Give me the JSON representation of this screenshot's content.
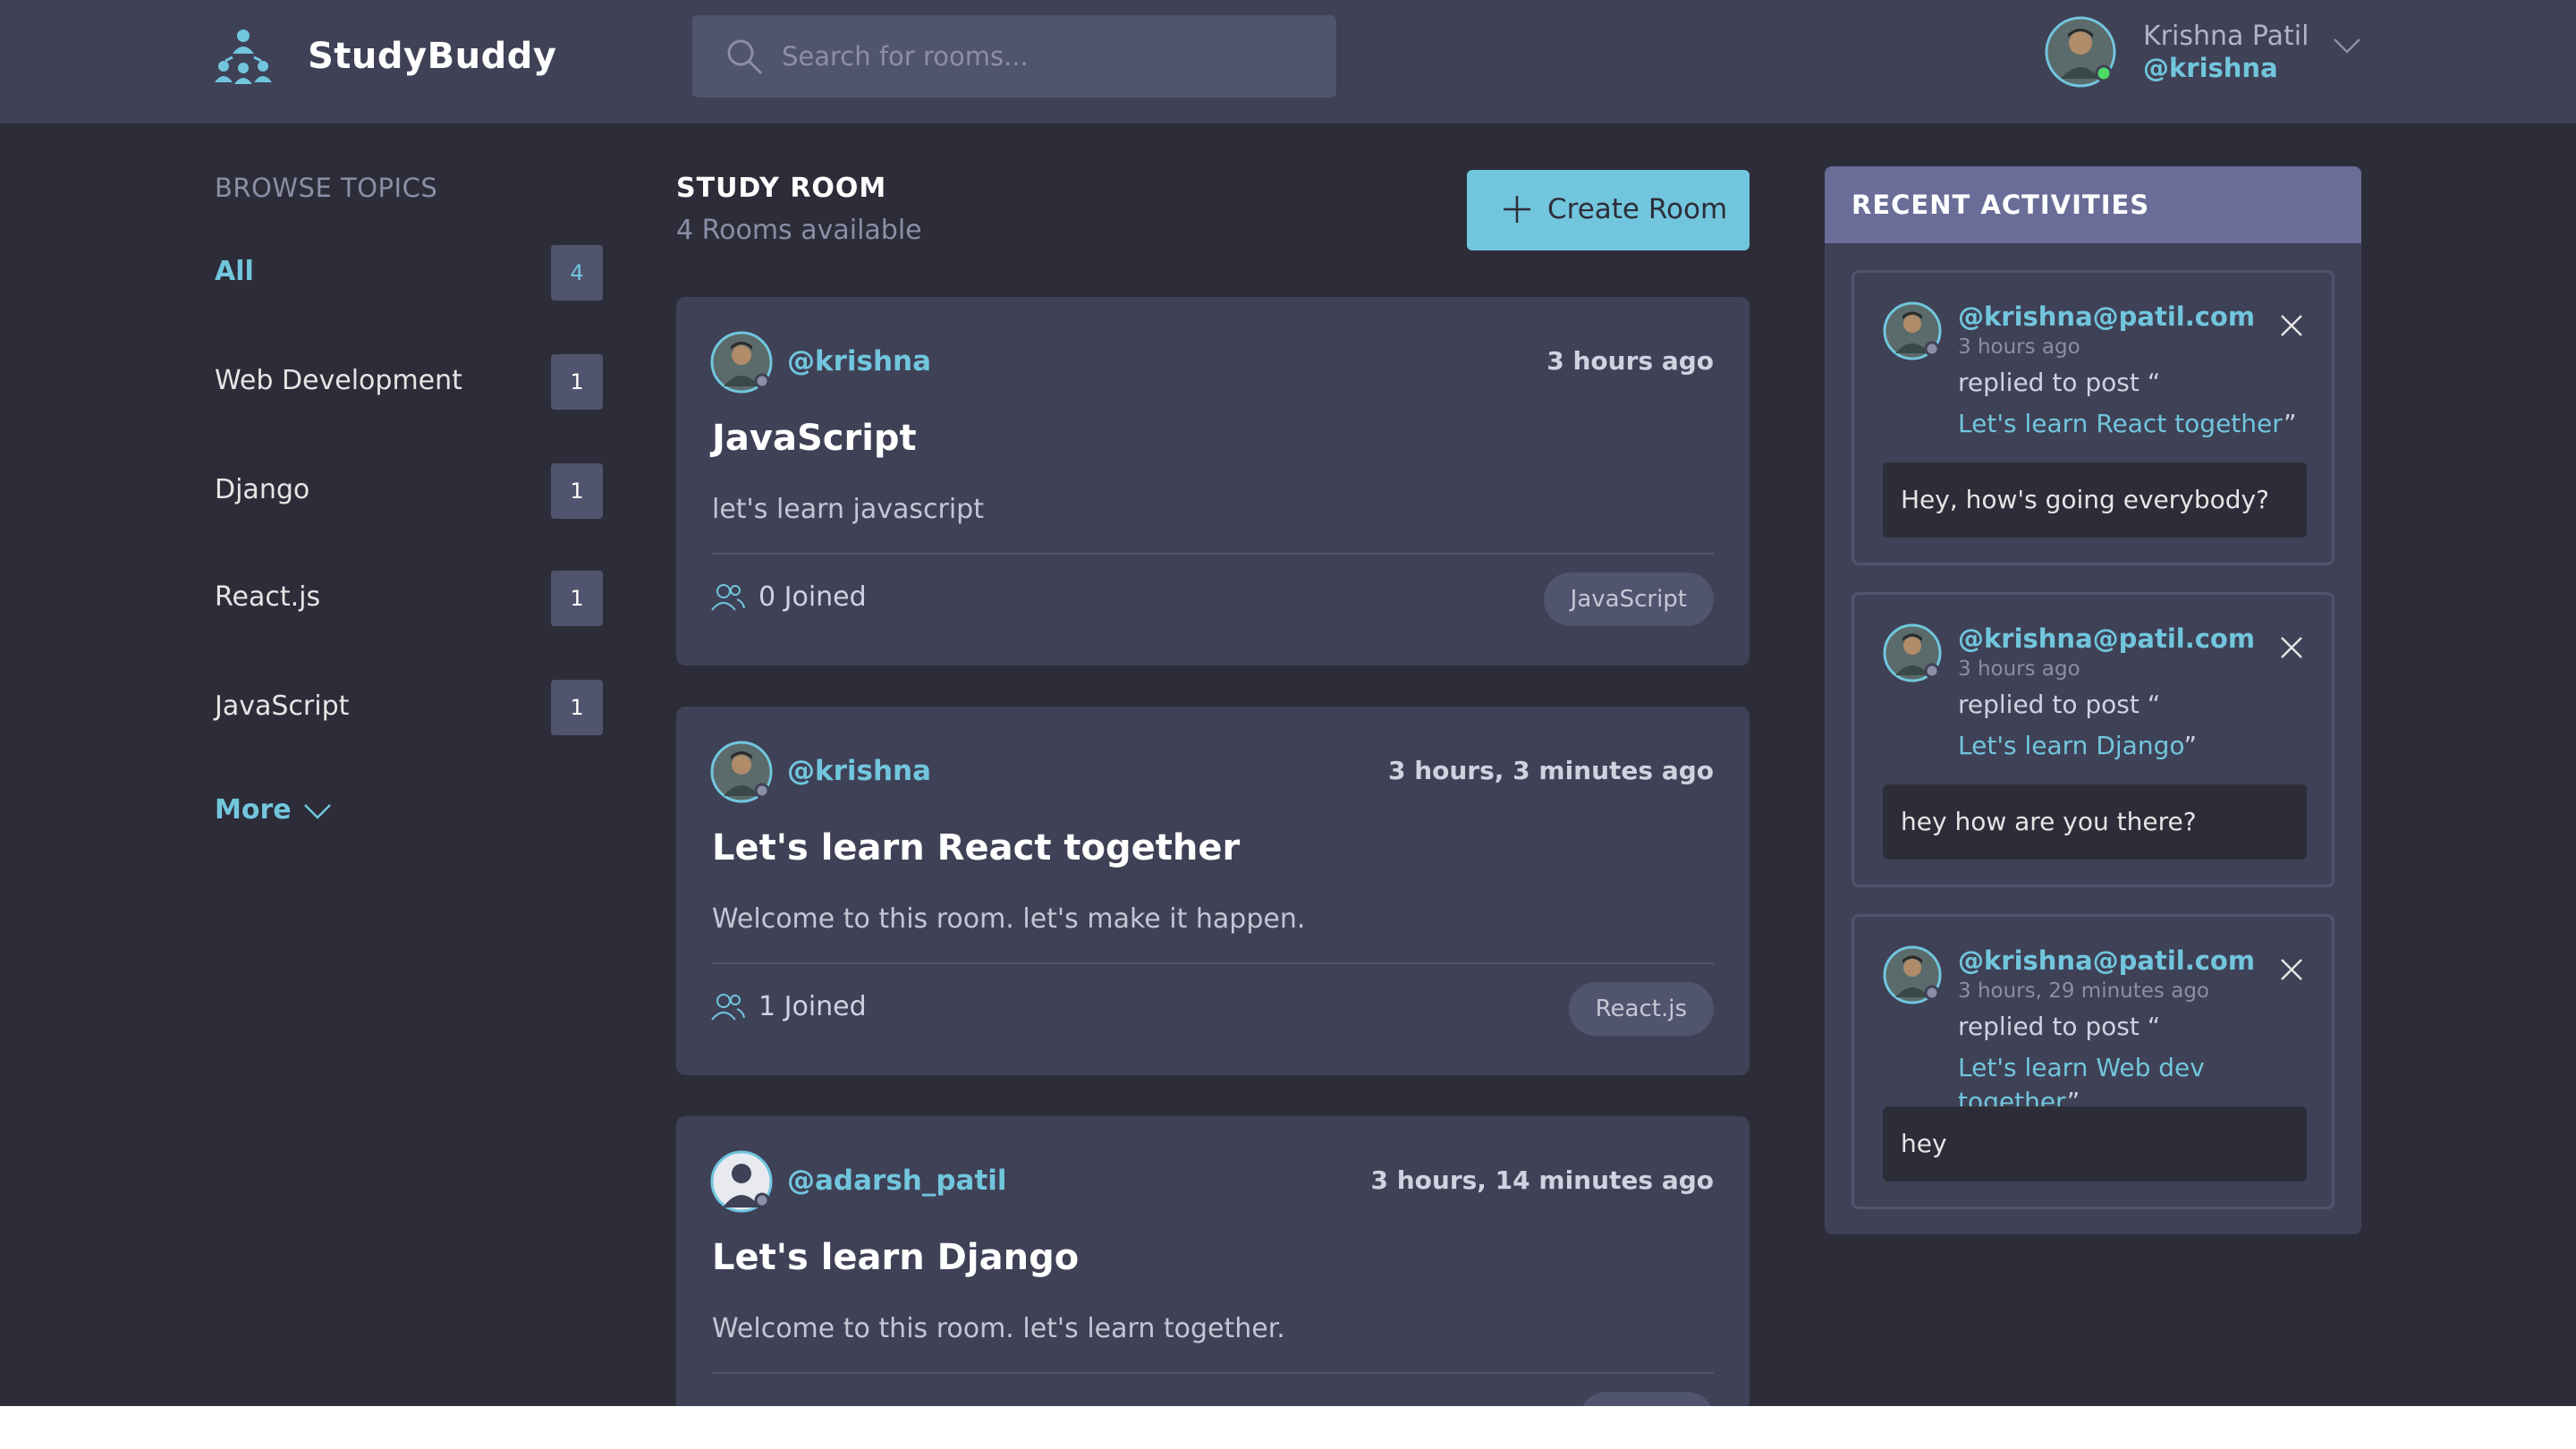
{
  "header": {
    "brand": "StudyBuddy",
    "search_placeholder": "Search for rooms...",
    "user_name": "Krishna Patil",
    "user_handle": "@krishna"
  },
  "sidebar": {
    "title": "BROWSE TOPICS",
    "topics": [
      {
        "label": "All",
        "count": "4",
        "active": true
      },
      {
        "label": "Web Development",
        "count": "1"
      },
      {
        "label": "Django",
        "count": "1"
      },
      {
        "label": "React.js",
        "count": "1"
      },
      {
        "label": "JavaScript",
        "count": "1"
      }
    ],
    "more_label": "More"
  },
  "main": {
    "heading": "STUDY ROOM",
    "subheading": "4 Rooms available",
    "create_label": "Create Room",
    "rooms": [
      {
        "author": "@krishna",
        "time": "3 hours ago",
        "title": "JavaScript",
        "description": "let's learn javascript",
        "joined": "0 Joined",
        "tag": "JavaScript"
      },
      {
        "author": "@krishna",
        "time": "3 hours, 3 minutes ago",
        "title": "Let's learn React together",
        "description": "Welcome to this room. let's make it happen.",
        "joined": "1 Joined",
        "tag": "React.js"
      },
      {
        "author": "@adarsh_patil",
        "time": "3 hours, 14 minutes ago",
        "title": "Let's learn Django",
        "description": "Welcome to this room. let's learn together."
      }
    ]
  },
  "activities": {
    "title": "RECENT ACTIVITIES",
    "items": [
      {
        "email": "@krishna@patil.com",
        "time": "3 hours ago",
        "replied": "replied to post “",
        "post": "Let's learn React together",
        "close_quote": "”",
        "message": "Hey, how's going everybody?"
      },
      {
        "email": "@krishna@patil.com",
        "time": "3 hours ago",
        "replied": "replied to post “",
        "post": "Let's learn Django",
        "close_quote": "”",
        "message": "hey how are you there?"
      },
      {
        "email": "@krishna@patil.com",
        "time": "3 hours, 29 minutes ago",
        "replied": "replied to post “",
        "post": "Let's learn Web dev together",
        "close_quote": "”",
        "message": "hey"
      }
    ]
  },
  "colors": {
    "background": "#2d2d39",
    "header": "#3f4156",
    "accent": "#71c6dd",
    "panel_head": "#696d97"
  },
  "icons": {
    "logo": "people-network-icon",
    "search": "search-icon",
    "user_menu": "chevron-down-icon",
    "people": "users-icon",
    "close": "close-icon",
    "create": "plus-icon"
  }
}
